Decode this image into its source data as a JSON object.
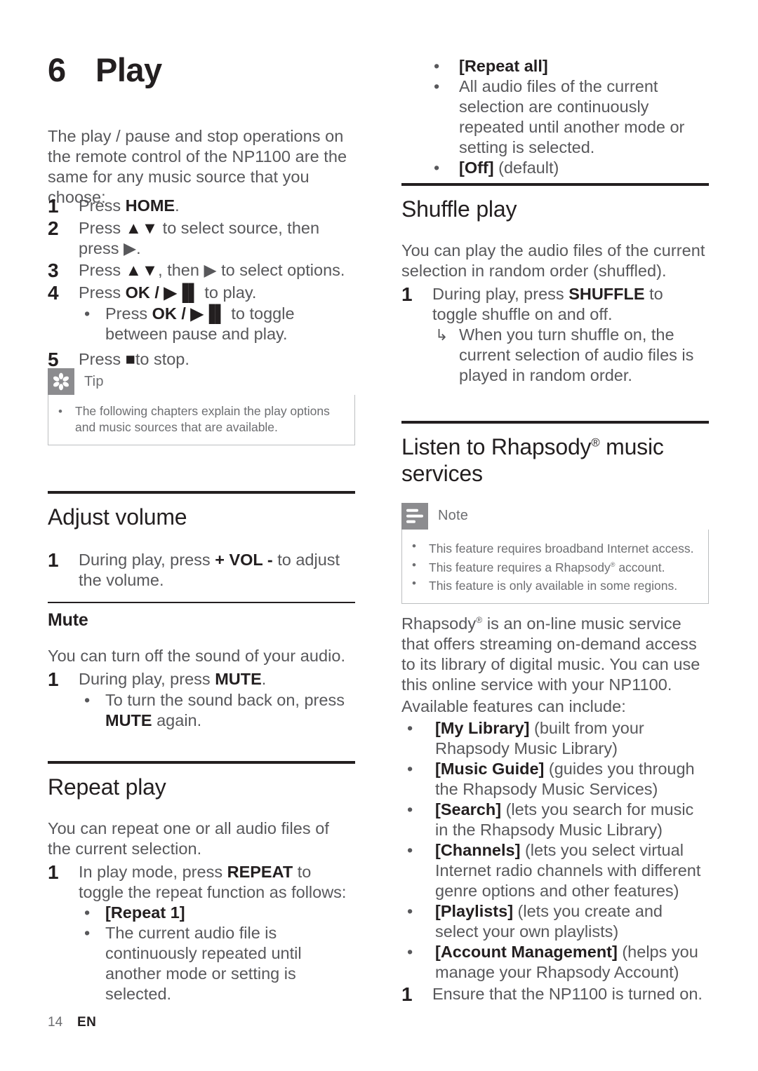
{
  "meta": {
    "chapter_number": "6",
    "chapter_title": "Play",
    "page_number": "14",
    "language": "EN",
    "accent_gray": "#8c8c8f",
    "text_gray": "#58585b",
    "heading_black": "#231f20",
    "box_border": "#bcbec0"
  },
  "intro": {
    "paragraph": "The play / pause and stop operations on the remote control of the NP1100 are the same for any music source that you choose:"
  },
  "play_steps": [
    {
      "num": "1",
      "text_before": "Press ",
      "bold": "HOME",
      "text_after": "."
    },
    {
      "num": "2",
      "text_before": "Press ",
      "bold": "▲▼",
      "text_after": " to select source, then press ▶."
    },
    {
      "num": "3",
      "text_before": "Press ",
      "bold": "▲▼",
      "text_after": ", then ▶ to select options."
    },
    {
      "num": "4",
      "text_before": "Press ",
      "bold": "OK / ▶▐▌",
      "text_after": " to play."
    },
    {
      "num": "5",
      "text_before": "Press ",
      "bold": "■",
      "text_after": "to stop."
    }
  ],
  "play_step4_bullet": {
    "dot": "•",
    "text_before": "Press ",
    "bold": "OK / ▶▐▌",
    "text_after": " to toggle between pause and play."
  },
  "tip_box": {
    "icon_name": "tip-asterisk-icon",
    "label": "Tip",
    "items": [
      {
        "dot": "•",
        "text": "The following chapters explain the play options and music sources that are available."
      }
    ]
  },
  "adjust_volume": {
    "heading": "Adjust volume",
    "steps": [
      {
        "num": "1",
        "text_before": "During play, press ",
        "bold": "+ VOL -",
        "text_after": " to adjust the volume."
      }
    ]
  },
  "mute": {
    "heading": "Mute",
    "paragraph": "You can turn off the sound of your audio.",
    "steps": [
      {
        "num": "1",
        "text_before": "During play, press ",
        "bold": "MUTE",
        "text_after": "."
      }
    ],
    "bullet": {
      "dot": "•",
      "text_before": "To turn the sound back on, press ",
      "bold": "MUTE",
      "text_after": " again."
    }
  },
  "repeat_play": {
    "heading": "Repeat play",
    "paragraph": "You can repeat one or all audio files of the current selection.",
    "step": {
      "num": "1",
      "text_before": "In play mode, press ",
      "bold": "REPEAT",
      "text_after": " to toggle the repeat function as follows:"
    },
    "bullets": [
      {
        "dot": "•",
        "bold": "[Repeat 1]",
        "rest": ""
      },
      {
        "dot": "•",
        "bold": "",
        "rest": "The current audio file is continuously repeated until another mode or setting is selected."
      },
      {
        "dot": "•",
        "bold": "[Repeat all]",
        "rest": ""
      },
      {
        "dot": "•",
        "bold": "",
        "rest": "All audio files of the current selection are continuously repeated until another mode or setting is selected."
      },
      {
        "dot": "•",
        "bold": "[Off]",
        "rest": " (default)"
      }
    ]
  },
  "shuffle_play": {
    "heading": "Shuffle play",
    "paragraph": "You can play the audio files of the current selection in random order (shuffled).",
    "step": {
      "num": "1",
      "text_before": "During play, press ",
      "bold": "SHUFFLE",
      "text_after": " to toggle shuffle on and off."
    },
    "result": {
      "arrow": "↳",
      "text": "When you turn shuffle on, the current selection of audio files is played in random order."
    }
  },
  "rhapsody": {
    "heading_part1": "Listen to Rhapsody",
    "heading_sup": "®",
    "heading_part2": " music services",
    "note_box": {
      "icon_name": "note-lines-icon",
      "label": "Note",
      "items": [
        {
          "dot": "•",
          "text_before": "This feature requires broadband Internet access.",
          "sup": "",
          "text_after": ""
        },
        {
          "dot": "•",
          "text_before": "This feature requires a Rhapsody",
          "sup": "®",
          "text_after": " account."
        },
        {
          "dot": "•",
          "text_before": "This feature is only available in some regions.",
          "sup": "",
          "text_after": ""
        }
      ]
    },
    "paragraph_part1": "Rhapsody",
    "paragraph_sup": "®",
    "paragraph_part2": " is an on-line music service that offers streaming on-demand access to its library of digital music. You can use this online service with your NP1100.",
    "features_intro": "Available features can include:",
    "features": [
      {
        "dot": "•",
        "bold": "[My Library]",
        "rest": " (built from your Rhapsody Music Library)"
      },
      {
        "dot": "•",
        "bold": "[Music Guide]",
        "rest": " (guides you through the Rhapsody Music Services)"
      },
      {
        "dot": "•",
        "bold": "[Search]",
        "rest": " (lets you search for music in the Rhapsody Music Library)"
      },
      {
        "dot": "•",
        "bold": "[Channels]",
        "rest": " (lets you select virtual Internet radio channels with different genre options and other features)"
      },
      {
        "dot": "•",
        "bold": "[Playlists]",
        "rest": " (lets you create and select your own playlists)"
      },
      {
        "dot": "•",
        "bold": "[Account Management]",
        "rest": " (helps you manage your Rhapsody Account)"
      }
    ],
    "final_step": {
      "num": "1",
      "text": "Ensure that the NP1100 is turned on."
    }
  }
}
